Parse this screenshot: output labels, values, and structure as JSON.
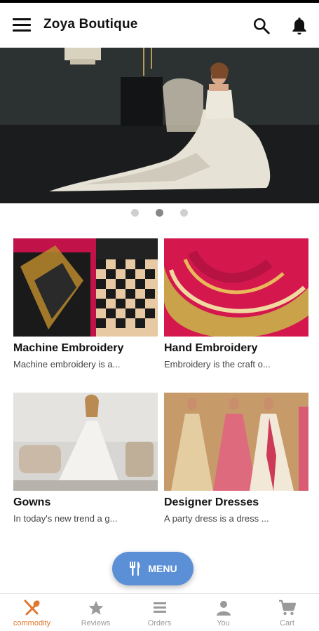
{
  "app": {
    "title": "Zoya Boutique"
  },
  "carousel": {
    "count": 3,
    "active_index": 1
  },
  "cards": [
    {
      "name": "Machine Embroidery",
      "desc": "Machine embroidery is a..."
    },
    {
      "name": "Hand Embroidery",
      "desc": "Embroidery is the craft o..."
    },
    {
      "name": "Gowns",
      "desc": "In today's new trend a g..."
    },
    {
      "name": "Designer Dresses",
      "desc": "A party dress is a dress ..."
    }
  ],
  "fab": {
    "label": "MENU",
    "icon": "fork-knife-icon",
    "color": "#5b8fd6"
  },
  "bottom_nav": [
    {
      "label": "commodity",
      "icon": "fork-spoon-icon",
      "active": true
    },
    {
      "label": "Reviews",
      "icon": "star-icon",
      "active": false
    },
    {
      "label": "Orders",
      "icon": "list-icon",
      "active": false
    },
    {
      "label": "You",
      "icon": "person-icon",
      "active": false
    },
    {
      "label": "Cart",
      "icon": "cart-icon",
      "active": false
    }
  ],
  "colors": {
    "accent": "#e0782e",
    "inactive": "#9a9a9a"
  }
}
